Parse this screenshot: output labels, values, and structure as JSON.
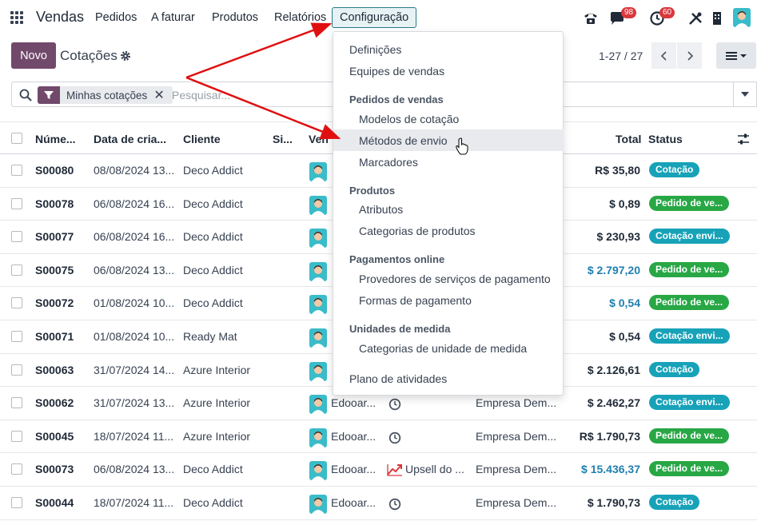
{
  "navbar": {
    "brand": "Vendas",
    "items": [
      "Pedidos",
      "A faturar",
      "Produtos",
      "Relatórios",
      "Configuração"
    ],
    "messages_badge": "98",
    "activities_badge": "60"
  },
  "control": {
    "new_button": "Novo",
    "title": "Cotações",
    "pager": "1-27 / 27"
  },
  "search": {
    "facet": "Minhas cotações",
    "placeholder": "Pesquisar..."
  },
  "table": {
    "headers": [
      "Núme...",
      "Data de cria...",
      "Cliente",
      "Si...",
      "Ven",
      "Total",
      "Status"
    ],
    "rows": [
      {
        "number": "S00080",
        "date": "08/08/2024 13...",
        "customer": "Deco Addict",
        "seller": "",
        "activity": "",
        "company": "",
        "total": "R$ 35,80",
        "status": "Cotação"
      },
      {
        "number": "S00078",
        "date": "06/08/2024 16...",
        "customer": "Deco Addict",
        "seller": "",
        "activity": "",
        "company": "",
        "total": "$ 0,89",
        "status": "Pedido de ve..."
      },
      {
        "number": "S00077",
        "date": "06/08/2024 16...",
        "customer": "Deco Addict",
        "seller": "",
        "activity": "",
        "company": "",
        "total": "$ 230,93",
        "status": "Cotação envi..."
      },
      {
        "number": "S00075",
        "date": "06/08/2024 13...",
        "customer": "Deco Addict",
        "seller": "",
        "activity": "",
        "company": "",
        "total": "$ 2.797,20",
        "status": "Pedido de ve..."
      },
      {
        "number": "S00072",
        "date": "01/08/2024 10...",
        "customer": "Deco Addict",
        "seller": "",
        "activity": "",
        "company": "",
        "total": "$ 0,54",
        "status": "Pedido de ve..."
      },
      {
        "number": "S00071",
        "date": "01/08/2024 10...",
        "customer": "Ready Mat",
        "seller": "",
        "activity": "",
        "company": "",
        "total": "$ 0,54",
        "status": "Cotação envi..."
      },
      {
        "number": "S00063",
        "date": "31/07/2024 14...",
        "customer": "Azure Interior",
        "seller": "",
        "activity": "",
        "company": "",
        "total": "$ 2.126,61",
        "status": "Cotação"
      },
      {
        "number": "S00062",
        "date": "31/07/2024 13...",
        "customer": "Azure Interior",
        "seller": "Edooar...",
        "activity": "",
        "company": "Empresa Dem...",
        "total": "$ 2.462,27",
        "status": "Cotação envi..."
      },
      {
        "number": "S00045",
        "date": "18/07/2024 11...",
        "customer": "Azure Interior",
        "seller": "Edooar...",
        "activity": "",
        "company": "Empresa Dem...",
        "total": "R$ 1.790,73",
        "status": "Pedido de ve..."
      },
      {
        "number": "S00073",
        "date": "06/08/2024 13...",
        "customer": "Deco Addict",
        "seller": "Edooar...",
        "activity": "Upsell do ...",
        "company": "Empresa Dem...",
        "total": "$ 15.436,37",
        "status": "Pedido de ve..."
      },
      {
        "number": "S00044",
        "date": "18/07/2024 11...",
        "customer": "Deco Addict",
        "seller": "Edooar...",
        "activity": "",
        "company": "Empresa Dem...",
        "total": "$ 1.790,73",
        "status": "Cotação"
      }
    ]
  },
  "menu": {
    "items": [
      {
        "label": "Definições",
        "kind": "item"
      },
      {
        "label": "Equipes de vendas",
        "kind": "item"
      },
      {
        "label": "Pedidos de vendas",
        "kind": "header"
      },
      {
        "label": "Modelos de cotação",
        "kind": "sub"
      },
      {
        "label": "Métodos de envio",
        "kind": "sub"
      },
      {
        "label": "Marcadores",
        "kind": "sub"
      },
      {
        "label": "Produtos",
        "kind": "header"
      },
      {
        "label": "Atributos",
        "kind": "sub"
      },
      {
        "label": "Categorias de produtos",
        "kind": "sub"
      },
      {
        "label": "Pagamentos online",
        "kind": "header"
      },
      {
        "label": "Provedores de serviços de pagamento",
        "kind": "sub"
      },
      {
        "label": "Formas de pagamento",
        "kind": "sub"
      },
      {
        "label": "Unidades de medida",
        "kind": "header"
      },
      {
        "label": "Categorias de unidade de medida",
        "kind": "sub"
      },
      {
        "label": "Plano de atividades",
        "kind": "item"
      }
    ]
  },
  "colors": {
    "brand": "#71496b",
    "quote_badge": "#17a2b8",
    "order_badge": "#28a745",
    "annotation_arrow": "#e01010"
  }
}
